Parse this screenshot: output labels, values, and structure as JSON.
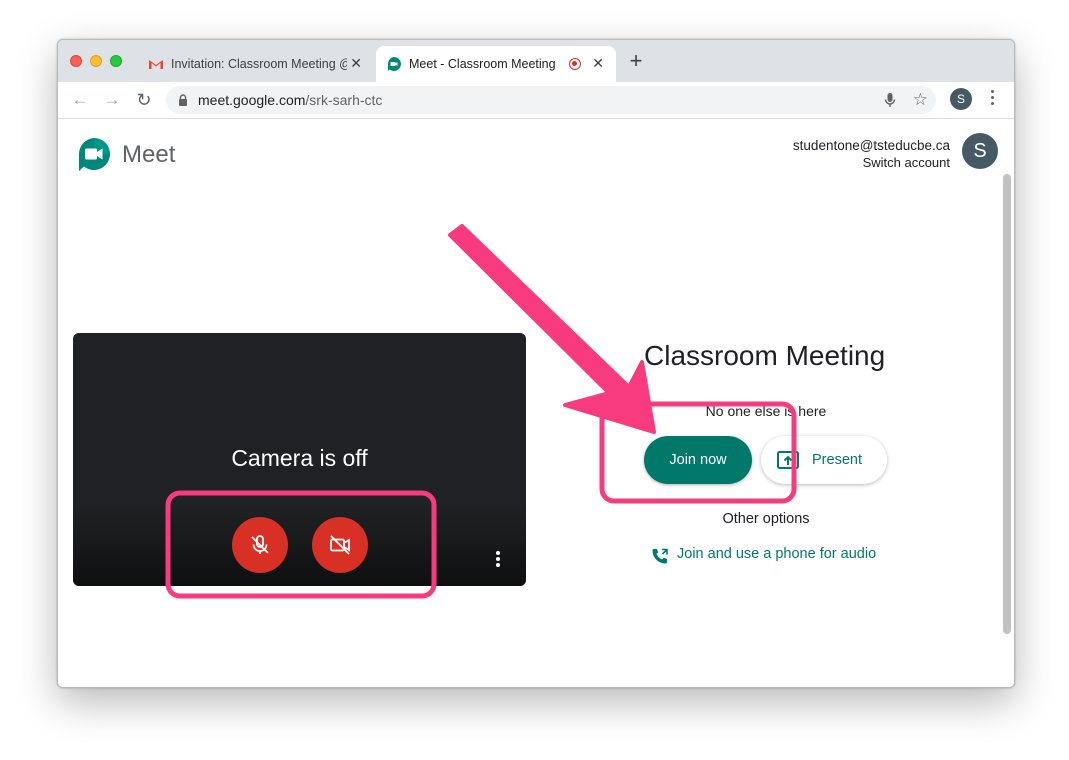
{
  "browser": {
    "tabs": [
      {
        "title": "Invitation: Classroom Meeting @ ",
        "icon": "gmail-icon",
        "active": false
      },
      {
        "title": "Meet - Classroom Meeting",
        "icon": "meet-icon",
        "active": true
      }
    ],
    "url_host": "meet.google.com",
    "url_path": "/srk-sarh-ctc",
    "profile_initial": "S"
  },
  "header": {
    "app_name": "Meet",
    "account_email": "studentone@tsteducbe.ca",
    "switch_account": "Switch account",
    "avatar_initial": "S"
  },
  "preview": {
    "status_text": "Camera is off",
    "mic_state": "off",
    "camera_state": "off"
  },
  "join_panel": {
    "meeting_title": "Classroom Meeting",
    "status": "No one else is here",
    "join_label": "Join now",
    "present_label": "Present",
    "other_options": "Other options",
    "phone_audio_label": "Join and use a phone for audio"
  },
  "colors": {
    "accent_teal": "#00796b",
    "control_red": "#d93025",
    "annotation_pink": "#f73b7e"
  }
}
